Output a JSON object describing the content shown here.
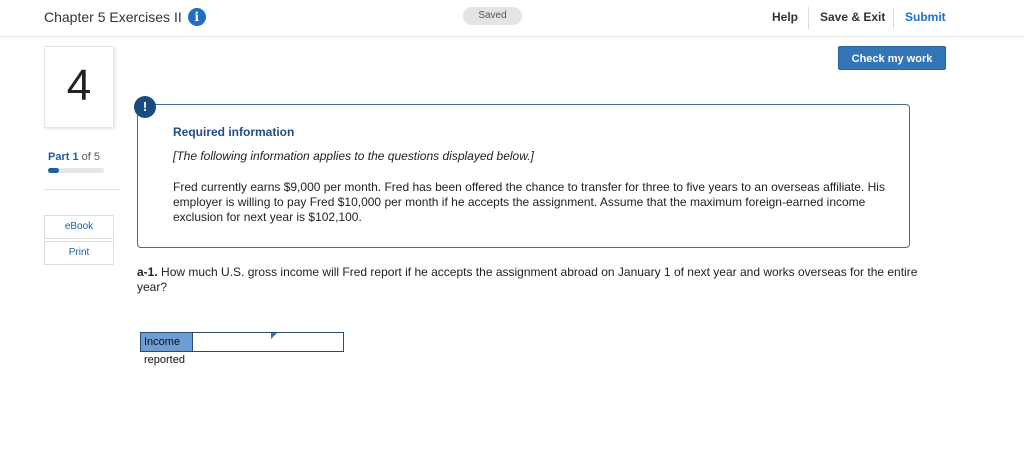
{
  "header": {
    "title": "Chapter 5 Exercises II",
    "info_icon": "info-icon",
    "saved_label": "Saved",
    "help_label": "Help",
    "save_exit_label": "Save & Exit",
    "submit_label": "Submit",
    "accent_color": "#1f6fc5"
  },
  "sidebar": {
    "question_number": "4",
    "part_prefix": "Part",
    "part_current": "1",
    "part_of": "of 5",
    "progress_fraction": 0.2,
    "ebook_label": "eBook",
    "print_label": "Print"
  },
  "toolbar": {
    "check_label": "Check my work"
  },
  "required_info": {
    "alert_icon": "exclamation-icon",
    "alert_glyph": "!",
    "title": "Required information",
    "subtitle": "[The following information applies to the questions displayed below.]",
    "body": "Fred currently earns $9,000 per month. Fred has been offered the chance to transfer for three to five years to an overseas affiliate. His employer is willing to pay Fred $10,000 per month if he accepts the assignment. Assume that the maximum foreign-earned income exclusion for next year is $102,100."
  },
  "question": {
    "number": "a-1.",
    "text": "How much U.S. gross income will Fred report if he accepts the assignment abroad on January 1 of next year and works overseas for the entire year?"
  },
  "answer": {
    "label": "Income reported",
    "value": ""
  }
}
